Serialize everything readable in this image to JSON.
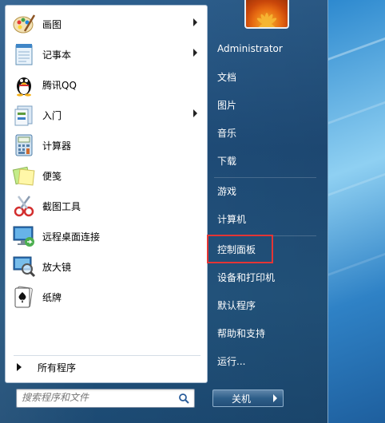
{
  "left_programs": [
    {
      "label": "画图",
      "icon": "paint-icon",
      "has_arrow": true
    },
    {
      "label": "记事本",
      "icon": "notepad-icon",
      "has_arrow": true
    },
    {
      "label": "腾讯QQ",
      "icon": "qq-penguin-icon",
      "has_arrow": false
    },
    {
      "label": "入门",
      "icon": "getting-started-icon",
      "has_arrow": true
    },
    {
      "label": "计算器",
      "icon": "calculator-icon",
      "has_arrow": false
    },
    {
      "label": "便笺",
      "icon": "sticky-notes-icon",
      "has_arrow": false
    },
    {
      "label": "截图工具",
      "icon": "snipping-tool-icon",
      "has_arrow": false
    },
    {
      "label": "远程桌面连接",
      "icon": "remote-desktop-icon",
      "has_arrow": false
    },
    {
      "label": "放大镜",
      "icon": "magnifier-icon",
      "has_arrow": false
    },
    {
      "label": "纸牌",
      "icon": "solitaire-icon",
      "has_arrow": false
    }
  ],
  "all_programs": "所有程序",
  "search": {
    "placeholder": "搜索程序和文件"
  },
  "right_items": {
    "user": "Administrator",
    "documents": "文档",
    "pictures": "图片",
    "music": "音乐",
    "downloads": "下载",
    "games": "游戏",
    "computer": "计算机",
    "control_panel": "控制面板",
    "devices": "设备和打印机",
    "default_programs": "默认程序",
    "help": "帮助和支持",
    "run": "运行..."
  },
  "shutdown": {
    "label": "关机"
  },
  "colors": {
    "highlight_box": "#e43535",
    "menu_bg": "#23557f"
  }
}
